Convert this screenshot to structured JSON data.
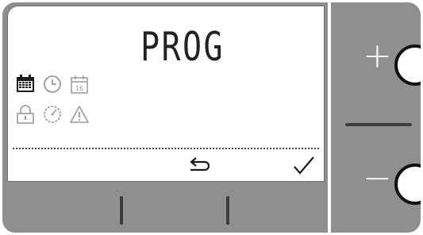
{
  "display": {
    "mode_text": "PROG",
    "calendar_day": "16"
  },
  "icons": {
    "row1": [
      "calendar-week-icon",
      "clock-icon",
      "calendar-day-icon"
    ],
    "row2": [
      "lock-icon",
      "gauge-icon",
      "warning-icon"
    ],
    "softkeys": [
      "back-arrow-icon",
      "checkmark-icon"
    ]
  },
  "buttons": {
    "plus": "+",
    "minus": "−"
  },
  "colors": {
    "housing": "#8f8f8f",
    "screen": "#ffffff",
    "active_icon": "#1a1a1a",
    "inactive_icon": "#9a9a9a"
  }
}
